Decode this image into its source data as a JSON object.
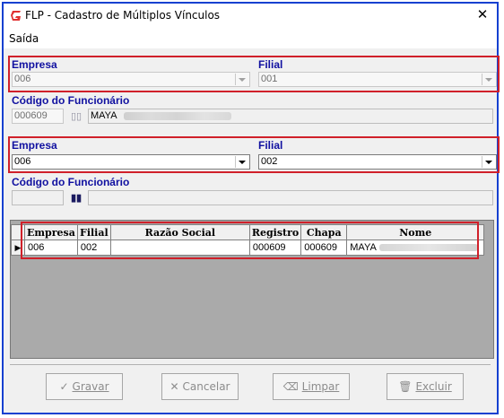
{
  "window": {
    "title": "FLP - Cadastro de Múltiplos Vínculos",
    "close_glyph": "✕"
  },
  "menu": {
    "items": [
      {
        "label": "Saída"
      }
    ]
  },
  "section1": {
    "empresa_label": "Empresa",
    "empresa_value": "006",
    "filial_label": "Filial",
    "filial_value": "001",
    "codigo_label": "Código do Funcionário",
    "codigo_value": "000609",
    "nome_value": "MAYA"
  },
  "section2": {
    "empresa_label": "Empresa",
    "empresa_value": "006",
    "filial_label": "Filial",
    "filial_value": "002",
    "codigo_label": "Código do Funcionário",
    "codigo_value": "",
    "nome_value": ""
  },
  "grid": {
    "columns": [
      "Empresa",
      "Filial",
      "Razão Social",
      "Registro",
      "Chapa",
      "Nome"
    ],
    "rows": [
      {
        "empresa": "006",
        "filial": "002",
        "razao_social": "",
        "registro": "000609",
        "chapa": "000609",
        "nome": "MAYA"
      }
    ]
  },
  "buttons": {
    "gravar": {
      "label": "Gravar",
      "icon": "✓"
    },
    "cancelar": {
      "label": "Cancelar",
      "icon": "✕"
    },
    "limpar": {
      "label": "Limpar",
      "icon": "⌫"
    },
    "excluir": {
      "label": "Excluir",
      "icon": "🗑"
    }
  },
  "colors": {
    "window_border": "#1540d0",
    "highlight": "#d0202a",
    "app_icon": "#e03030"
  }
}
